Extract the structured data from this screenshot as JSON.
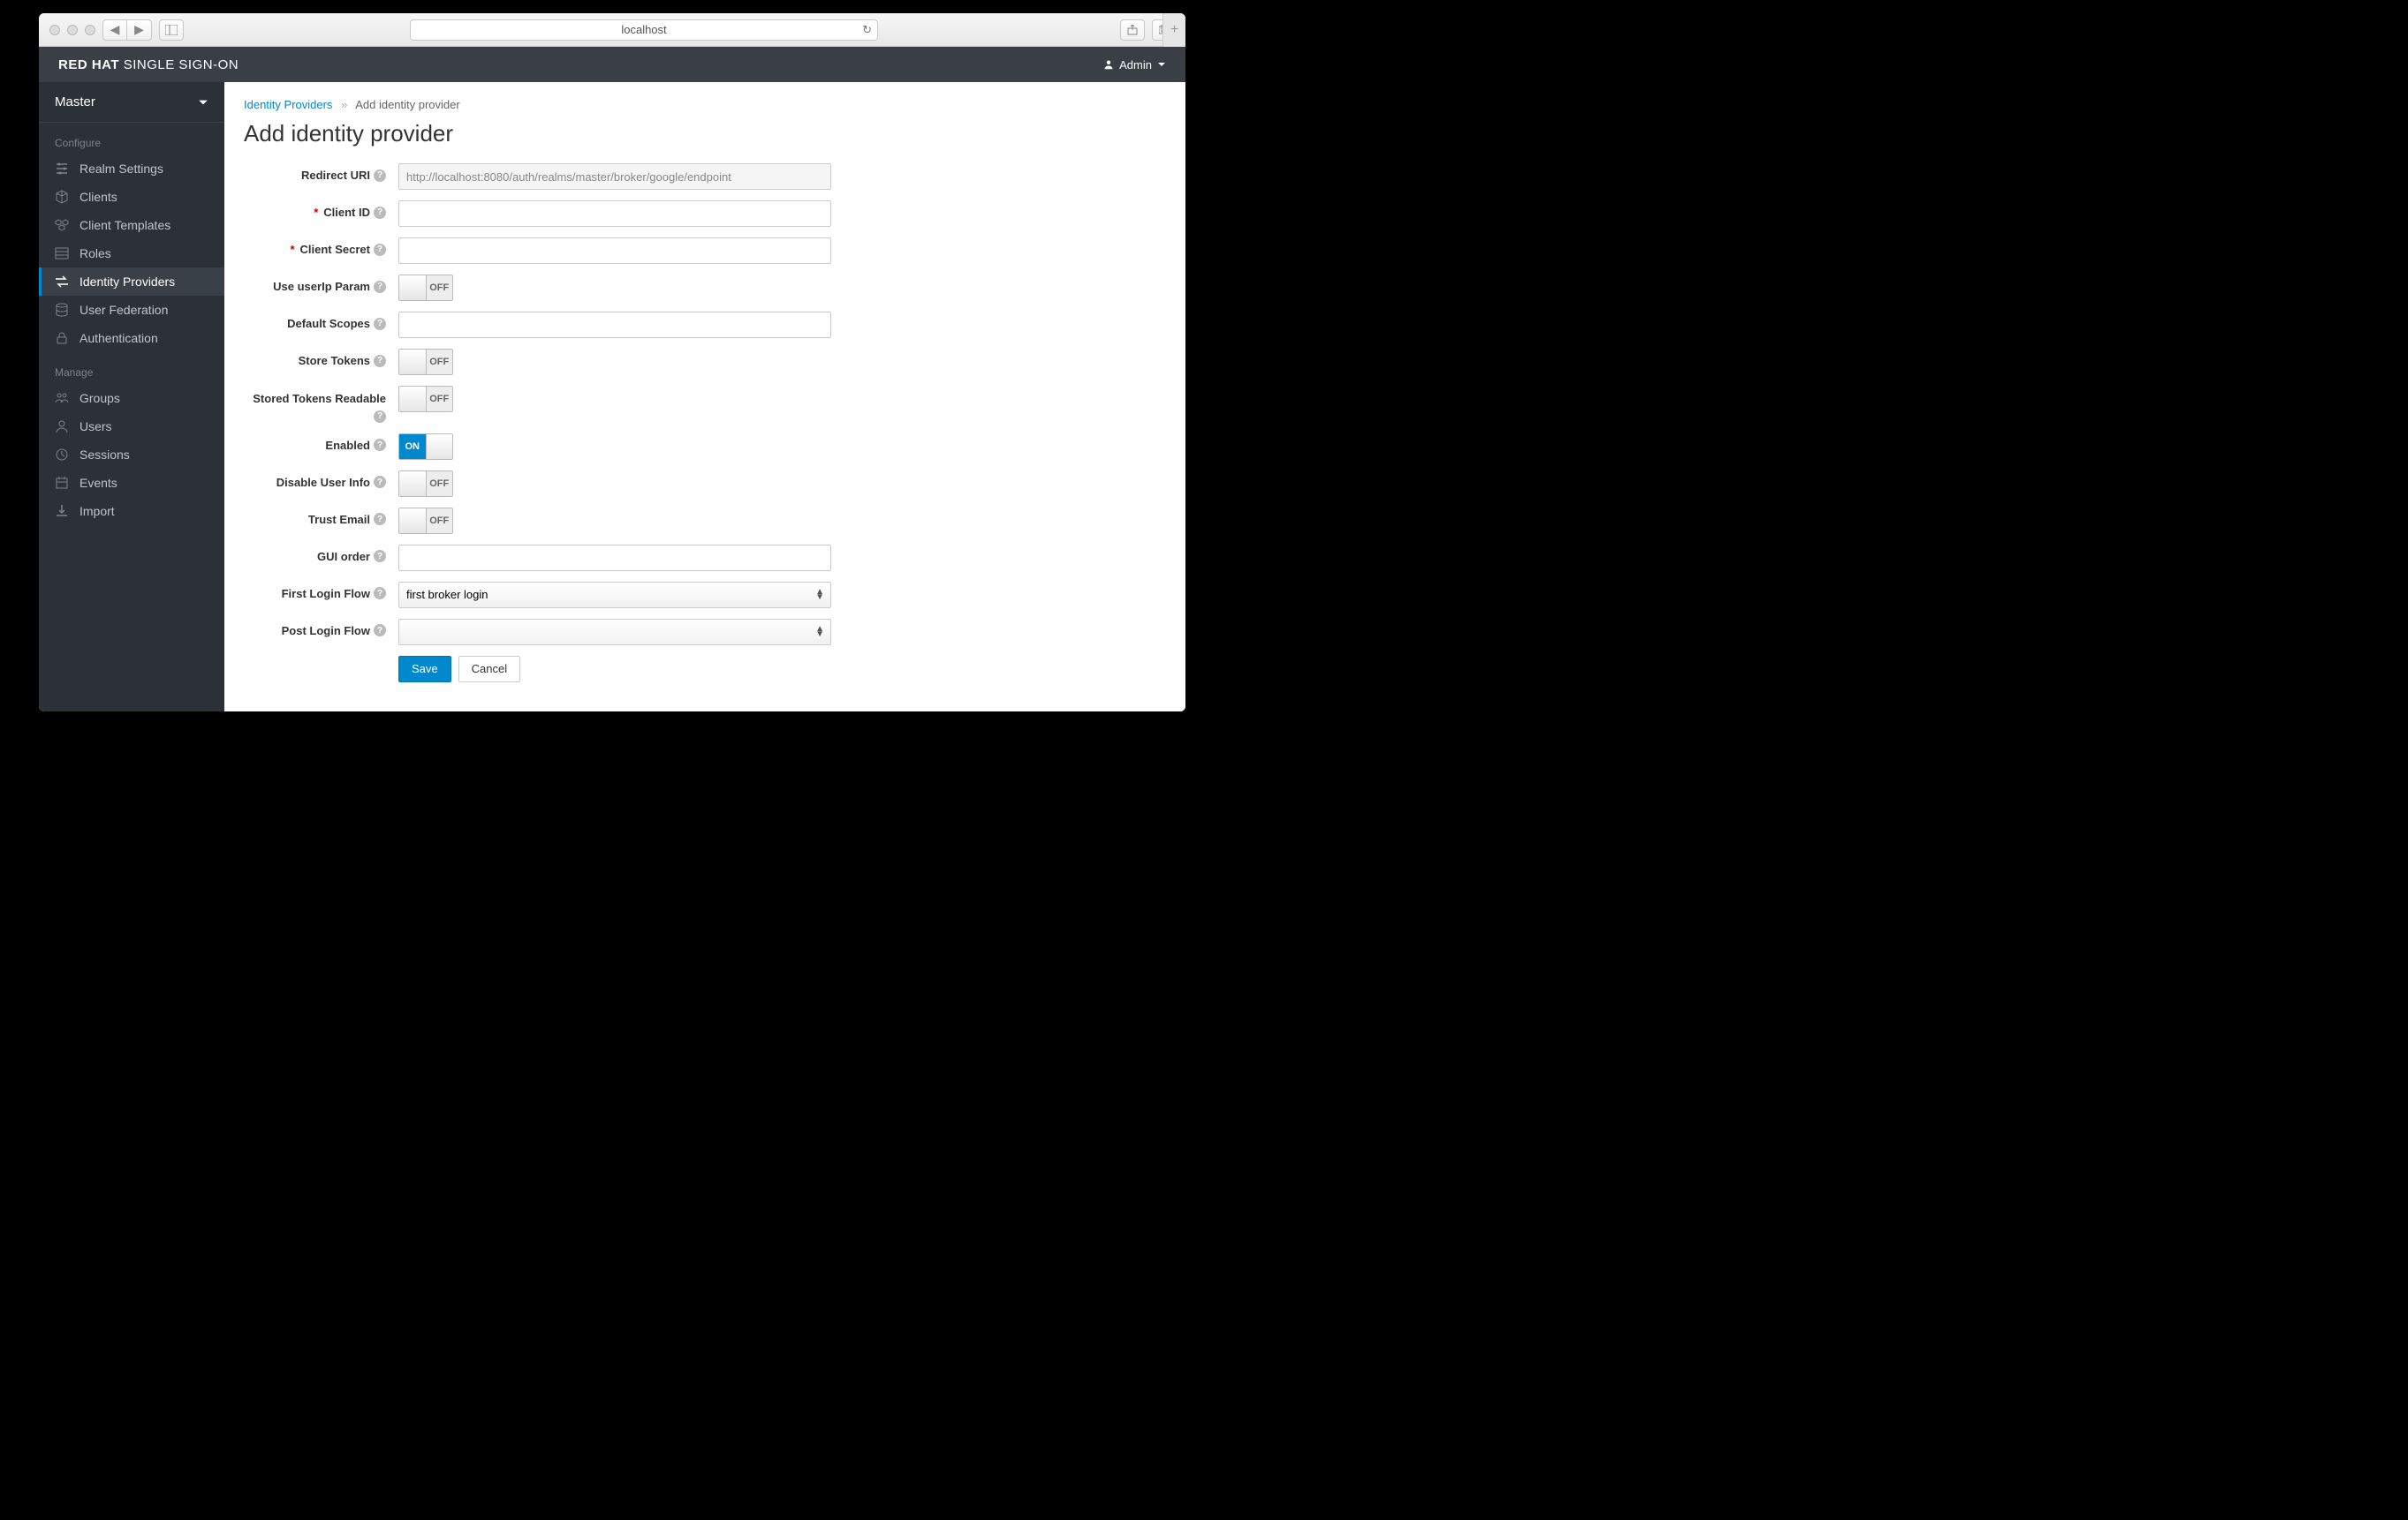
{
  "browser": {
    "url": "localhost"
  },
  "brand": {
    "bold": "RED HAT",
    "rest": " SINGLE SIGN-ON"
  },
  "user": {
    "name": "Admin"
  },
  "realm": {
    "name": "Master"
  },
  "nav": {
    "configure_label": "Configure",
    "manage_label": "Manage",
    "configure": [
      {
        "label": "Realm Settings"
      },
      {
        "label": "Clients"
      },
      {
        "label": "Client Templates"
      },
      {
        "label": "Roles"
      },
      {
        "label": "Identity Providers"
      },
      {
        "label": "User Federation"
      },
      {
        "label": "Authentication"
      }
    ],
    "manage": [
      {
        "label": "Groups"
      },
      {
        "label": "Users"
      },
      {
        "label": "Sessions"
      },
      {
        "label": "Events"
      },
      {
        "label": "Import"
      }
    ]
  },
  "breadcrumb": {
    "root": "Identity Providers",
    "current": "Add identity provider"
  },
  "page": {
    "title": "Add identity provider"
  },
  "form": {
    "redirect_uri": {
      "label": "Redirect URI",
      "value": "http://localhost:8080/auth/realms/master/broker/google/endpoint"
    },
    "client_id": {
      "label": "Client ID",
      "value": ""
    },
    "client_secret": {
      "label": "Client Secret",
      "value": ""
    },
    "use_userip": {
      "label": "Use userIp Param",
      "value": "OFF"
    },
    "default_scopes": {
      "label": "Default Scopes",
      "value": ""
    },
    "store_tokens": {
      "label": "Store Tokens",
      "value": "OFF"
    },
    "stored_tokens_readable": {
      "label": "Stored Tokens Readable",
      "value": "OFF"
    },
    "enabled": {
      "label": "Enabled",
      "value": "ON"
    },
    "disable_user_info": {
      "label": "Disable User Info",
      "value": "OFF"
    },
    "trust_email": {
      "label": "Trust Email",
      "value": "OFF"
    },
    "gui_order": {
      "label": "GUI order",
      "value": ""
    },
    "first_login_flow": {
      "label": "First Login Flow",
      "value": "first broker login"
    },
    "post_login_flow": {
      "label": "Post Login Flow",
      "value": ""
    }
  },
  "buttons": {
    "save": "Save",
    "cancel": "Cancel"
  }
}
